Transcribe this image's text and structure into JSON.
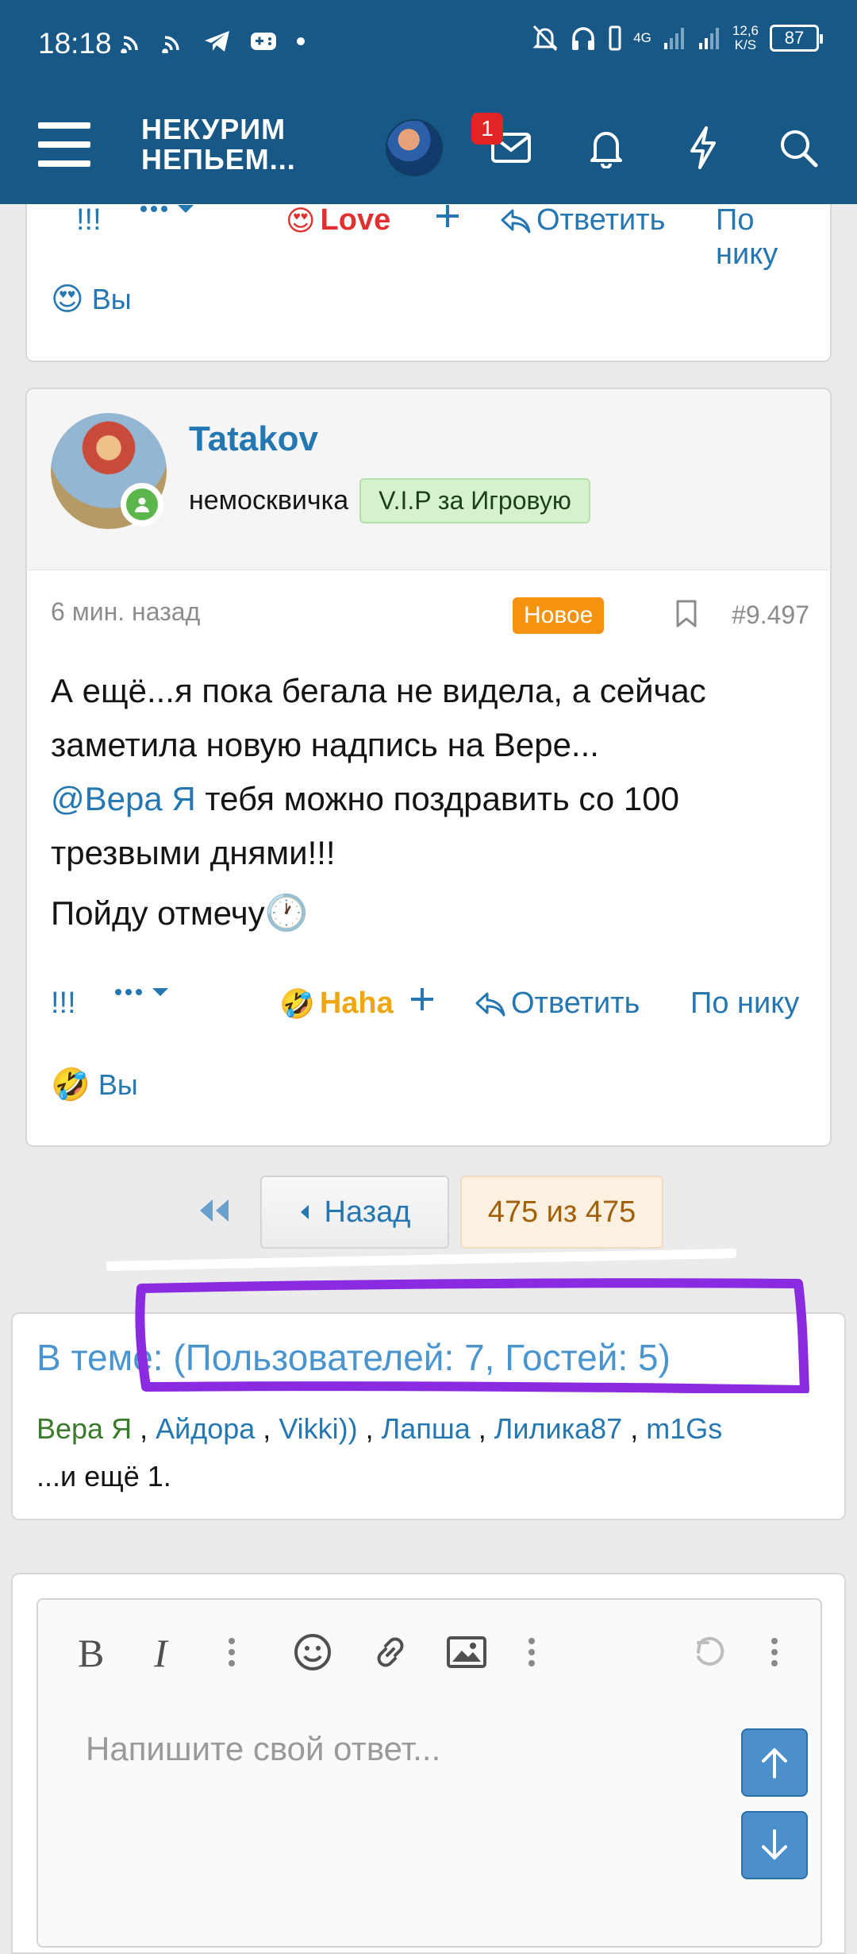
{
  "status_bar": {
    "time": "18:18",
    "network": "4G",
    "speed_value": "12,6",
    "speed_unit": "K/S",
    "battery": "87"
  },
  "header": {
    "logo_line1": "НЕКУРИМ",
    "logo_line2": "НЕПЬЕМ...",
    "inbox_badge": "1"
  },
  "prev_post": {
    "reaction_label": "Love",
    "reply_label": "Ответить",
    "by_nick_label": "По нику",
    "marker_label": "!!!",
    "reacted_by": "Вы"
  },
  "post": {
    "username": "Tatakov",
    "user_title": "немосквичка",
    "user_banner": "V.I.P за Игровую",
    "time": "6 мин. назад",
    "new_badge": "Новое",
    "post_number": "#9.497",
    "line1": "А ещё...я пока бегала не видела, а сейчас заметила новую надпись на Вере...",
    "mention": "@Вера Я",
    "line2": " тебя можно поздравить со 100 трезвыми днями!!!",
    "line3": "Пойду отмечу",
    "marker_label": "!!!",
    "reaction_label": "Haha",
    "reply_label": "Ответить",
    "by_nick_label": "По нику",
    "reacted_by": "Вы"
  },
  "pager": {
    "back_label": "Назад",
    "count_label": "475 из 475"
  },
  "online": {
    "heading": "В теме: (Пользователей: 7, Гостей: 5)",
    "users": [
      "Вера Я",
      "Айдора",
      "Vikki))",
      "Лапша",
      "Лилика87",
      "m1Gs"
    ],
    "more": "...и ещё 1."
  },
  "editor": {
    "placeholder": "Напишите свой ответ..."
  },
  "colors": {
    "header_bg": "#185886",
    "link": "#2577b1",
    "new_badge": "#f5920f",
    "vip_bg": "#d4f3cc",
    "marker": "#8a2be2"
  }
}
